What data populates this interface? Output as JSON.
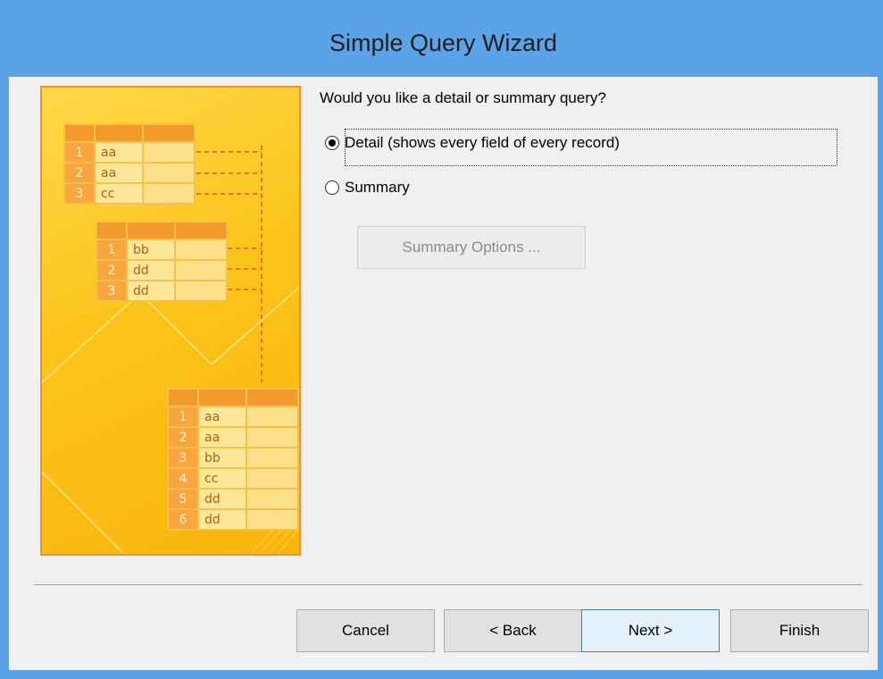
{
  "window": {
    "title": "Simple Query Wizard"
  },
  "prompt": "Would you like a detail or summary query?",
  "options": {
    "detail": {
      "label": "Detail (shows every field of every record)",
      "selected": true
    },
    "summary": {
      "label": "Summary",
      "selected": false
    }
  },
  "summary_options_button": "Summary Options ...",
  "illustration": {
    "table_a": [
      [
        "1",
        "aa"
      ],
      [
        "2",
        "aa"
      ],
      [
        "3",
        "cc"
      ]
    ],
    "table_b": [
      [
        "1",
        "bb"
      ],
      [
        "2",
        "dd"
      ],
      [
        "3",
        "dd"
      ]
    ],
    "table_result": [
      [
        "1",
        "aa"
      ],
      [
        "2",
        "aa"
      ],
      [
        "3",
        "bb"
      ],
      [
        "4",
        "cc"
      ],
      [
        "5",
        "dd"
      ],
      [
        "6",
        "dd"
      ]
    ]
  },
  "buttons": {
    "cancel": "Cancel",
    "back": "< Back",
    "next": "Next >",
    "finish": "Finish"
  },
  "colors": {
    "accent": "#5ba2e6",
    "illustration": "#fcc41a",
    "default_button_border": "#3c7fb1"
  }
}
